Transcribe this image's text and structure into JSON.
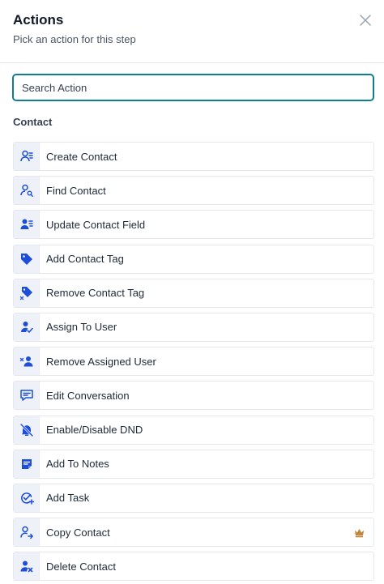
{
  "header": {
    "title": "Actions",
    "subtitle": "Pick an action for this step",
    "close_icon": "close-icon"
  },
  "search": {
    "placeholder": "Search Action",
    "value": ""
  },
  "section": {
    "label": "Contact"
  },
  "actions": [
    {
      "label": "Create Contact",
      "icon": "create-contact-icon"
    },
    {
      "label": "Find Contact",
      "icon": "find-contact-icon"
    },
    {
      "label": "Update Contact Field",
      "icon": "update-contact-field-icon"
    },
    {
      "label": "Add Contact Tag",
      "icon": "tag-icon"
    },
    {
      "label": "Remove Contact Tag",
      "icon": "remove-tag-icon"
    },
    {
      "label": "Assign To User",
      "icon": "assign-user-icon"
    },
    {
      "label": "Remove Assigned User",
      "icon": "remove-user-icon"
    },
    {
      "label": "Edit Conversation",
      "icon": "conversation-icon"
    },
    {
      "label": "Enable/Disable DND",
      "icon": "dnd-icon"
    },
    {
      "label": "Add To Notes",
      "icon": "notes-icon"
    },
    {
      "label": "Add Task",
      "icon": "add-task-icon"
    },
    {
      "label": "Copy Contact",
      "icon": "copy-contact-icon",
      "premium_icon": "crown-icon"
    },
    {
      "label": "Delete Contact",
      "icon": "delete-contact-icon"
    }
  ],
  "colors": {
    "accent": "#0f7f8f",
    "icon_blue": "#1d4ed8",
    "crown": "#c2873a",
    "icon_bg": "#eef2f8"
  }
}
